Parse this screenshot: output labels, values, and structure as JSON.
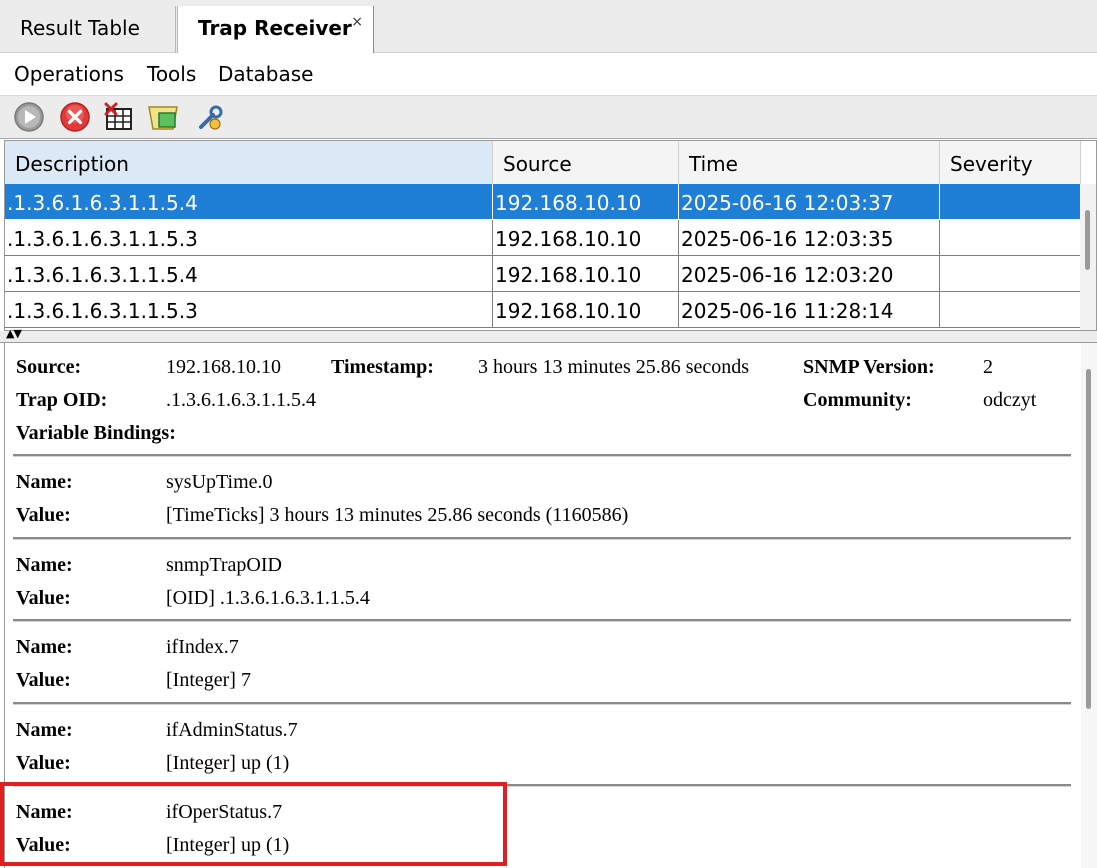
{
  "tabs": [
    {
      "label": "Result Table"
    },
    {
      "label": "Trap Receiver",
      "close": "×"
    }
  ],
  "menu": [
    "Operations",
    "Tools",
    "Database"
  ],
  "toolbar": {
    "icons": [
      "start-icon",
      "stop-icon",
      "delete-traps-icon",
      "trap-parser-icon",
      "settings-icon"
    ],
    "colors": {
      "start": "#8c8c8c",
      "stop": "#e03a3a",
      "accent": "#1f7fd6"
    }
  },
  "table": {
    "columns": [
      "Description",
      "Source",
      "Time",
      "Severity"
    ],
    "rows": [
      {
        "description": ".1.3.6.1.6.3.1.1.5.4",
        "source": "192.168.10.10",
        "time": "2025-06-16 12:03:37",
        "severity": ""
      },
      {
        "description": ".1.3.6.1.6.3.1.1.5.3",
        "source": "192.168.10.10",
        "time": "2025-06-16 12:03:35",
        "severity": ""
      },
      {
        "description": ".1.3.6.1.6.3.1.1.5.4",
        "source": "192.168.10.10",
        "time": "2025-06-16 12:03:20",
        "severity": ""
      },
      {
        "description": ".1.3.6.1.6.3.1.1.5.3",
        "source": "192.168.10.10",
        "time": "2025-06-16 11:28:14",
        "severity": ""
      }
    ]
  },
  "splitter": {
    "arrows": "▲▼"
  },
  "details": {
    "source_label": "Source:",
    "source": "192.168.10.10",
    "timestamp_label": "Timestamp:",
    "timestamp": "3 hours 13 minutes 25.86 seconds",
    "snmp_version_label": "SNMP Version:",
    "snmp_version": "2",
    "trap_oid_label": "Trap OID:",
    "trap_oid": ".1.3.6.1.6.3.1.1.5.4",
    "community_label": "Community:",
    "community": "odczyt",
    "bindings_label": "Variable Bindings:",
    "name_label": "Name:",
    "value_label": "Value:",
    "bindings": [
      {
        "name": "sysUpTime.0",
        "value": "[TimeTicks] 3 hours 13 minutes 25.86 seconds (1160586)"
      },
      {
        "name": "snmpTrapOID",
        "value": "[OID] .1.3.6.1.6.3.1.1.5.4"
      },
      {
        "name": "ifIndex.7",
        "value": "[Integer] 7"
      },
      {
        "name": "ifAdminStatus.7",
        "value": "[Integer] up (1)"
      },
      {
        "name": "ifOperStatus.7",
        "value": "[Integer] up (1)"
      }
    ]
  },
  "highlight_color": "#e02020"
}
